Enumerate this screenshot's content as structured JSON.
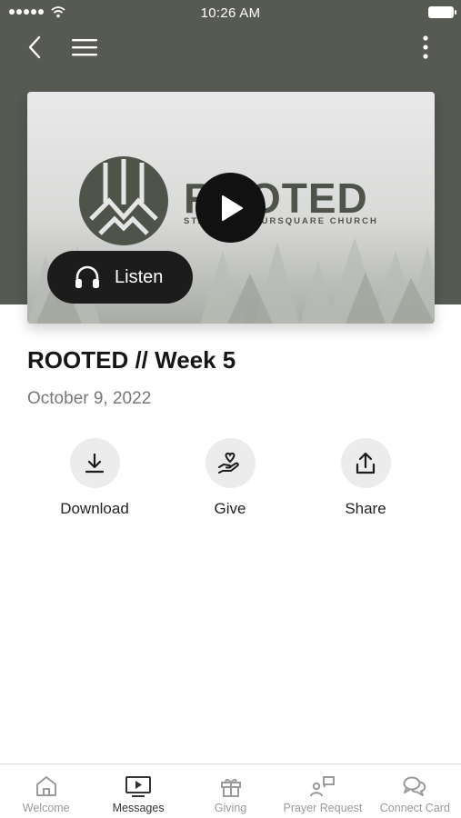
{
  "status_bar": {
    "time": "10:26 AM"
  },
  "navigation": {
    "back_icon": "chevron-left-icon",
    "menu_icon": "hamburger-menu-icon",
    "more_icon": "vertical-ellipsis-icon"
  },
  "media": {
    "artwork_title": "ROOTED",
    "artwork_subtitle": "STANDISH FOURSQUARE CHURCH",
    "play_icon": "play-icon",
    "listen_label": "Listen",
    "listen_icon": "headphones-icon"
  },
  "message": {
    "title": "ROOTED // Week 5",
    "date": "October 9, 2022"
  },
  "actions": [
    {
      "label": "Download",
      "icon": "download-icon"
    },
    {
      "label": "Give",
      "icon": "hand-heart-icon"
    },
    {
      "label": "Share",
      "icon": "share-icon"
    }
  ],
  "tabs": [
    {
      "label": "Welcome",
      "icon": "home-icon",
      "active": false
    },
    {
      "label": "Messages",
      "icon": "video-player-icon",
      "active": true
    },
    {
      "label": "Giving",
      "icon": "gift-icon",
      "active": false
    },
    {
      "label": "Prayer Request",
      "icon": "prayer-request-icon",
      "active": false
    },
    {
      "label": "Connect Card",
      "icon": "chat-bubbles-icon",
      "active": false
    }
  ],
  "colors": {
    "header_background": "#575a53",
    "artwork_text": "#4f544b",
    "button_dark": "#1c1c1c",
    "action_circle": "#ececec",
    "inactive_tab": "#9a9a9a"
  }
}
